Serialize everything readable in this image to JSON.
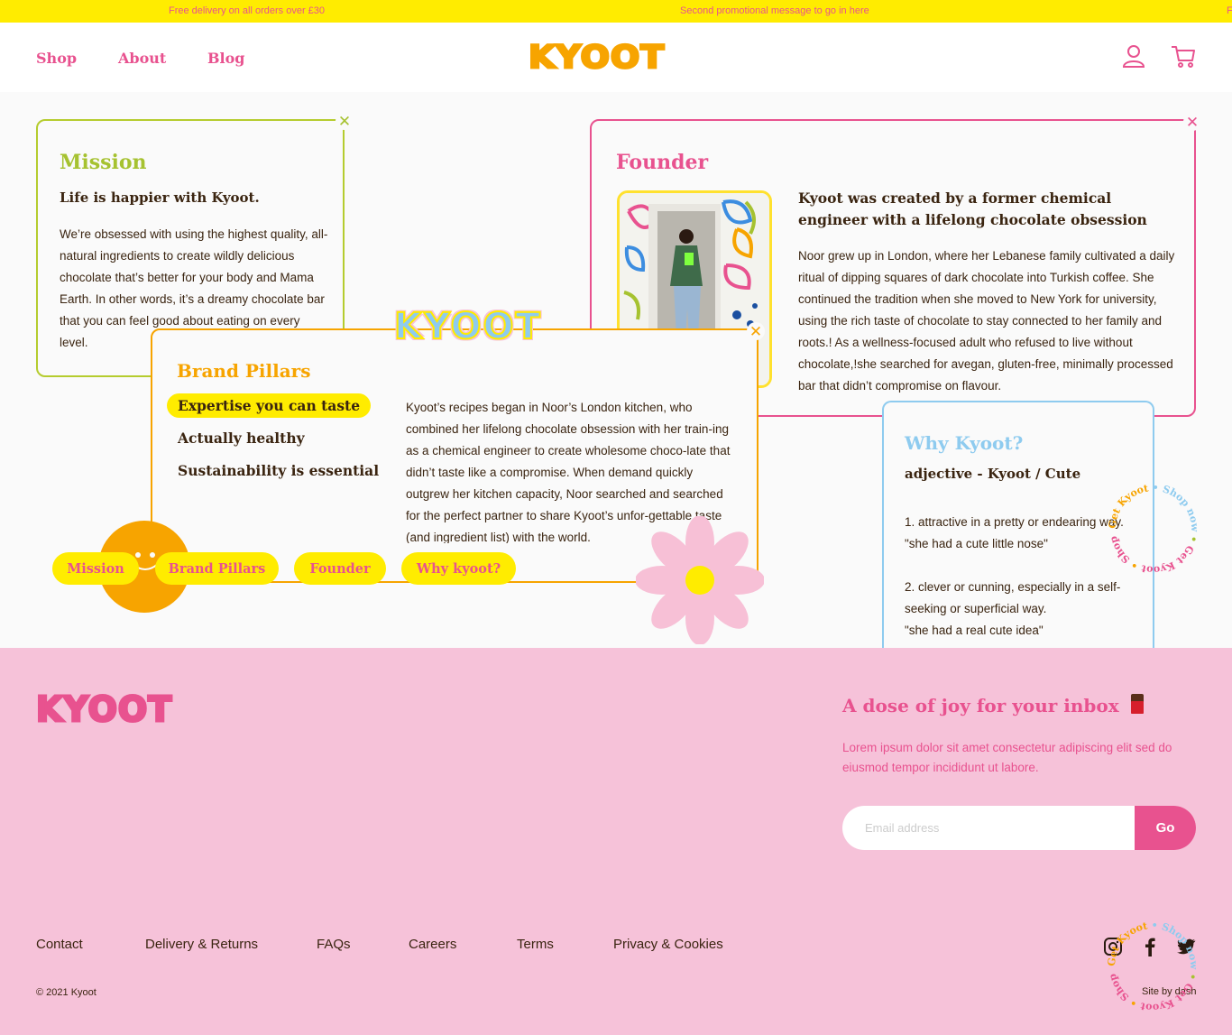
{
  "promo": {
    "message_1": "Free delivery on all orders over £30",
    "message_2": "Second promotional message to go in here",
    "message_3": "F"
  },
  "header": {
    "nav": [
      "Shop",
      "About",
      "Blog"
    ],
    "logo": "KYOOT",
    "icons": [
      "user-icon",
      "cart-icon"
    ]
  },
  "cards": {
    "mission": {
      "title": "Mission",
      "subtitle": "Life is happier with Kyoot.",
      "body": "We’re obsessed with using the highest quality, all-natural ingredients to create wildly delicious chocolate that’s better for your body and Mama Earth. In other words, it’s a dreamy chocolate bar that you can feel good about eating on every level."
    },
    "founder": {
      "title": "Founder",
      "subtitle": "Kyoot was created by a former chemical engineer with a lifelong chocolate obsession",
      "body": "Noor grew up in London, where her Lebanese family cultivated a daily ritual of dipping squares of dark chocolate into Turkish coffee. She continued the tradition when she moved to New York for university, using the rich taste of chocolate to stay connected to her family and roots.! As a wellness-focused adult who refused to live without chocolate,!she searched for avegan, gluten-free, minimally processed bar that didn’t compromise on flavour."
    },
    "brand_pillars": {
      "title": "Brand Pillars",
      "pillars": [
        "Expertise you can taste",
        "Actually healthy",
        "Sustainability is essential"
      ],
      "body": "Kyoot’s recipes began in Noor’s London kitchen, who combined her lifelong chocolate obsession with her train-ing as a chemical engineer to create wholesome choco-late that didn’t taste like a compromise. When demand quickly outgrew her kitchen capacity, Noor searched and searched for the perfect partner to share Kyoot’s unfor-gettable taste (and ingredient list) with the world."
    },
    "why": {
      "title": "Why Kyoot?",
      "subtitle": "adjective - Kyoot / Cute",
      "def1": "1. attractive in a pretty or endearing way.",
      "ex1": "\"she had a cute little nose\"",
      "def2": "2. clever or cunning, especially in a self-seeking or superficial way.",
      "ex2": "\"she had a real cute idea\""
    }
  },
  "sticker_logo": "KYOOT",
  "tabs": [
    "Mission",
    "Brand Pillars",
    "Founder",
    "Why kyoot?"
  ],
  "stamp_text": "Get Kyoot • Shop now • Get Kyoot • Shop now •",
  "footer": {
    "logo": "KYOOT",
    "newsletter_title": "A dose of joy for your inbox",
    "newsletter_text": "Lorem ipsum dolor sit amet consectetur adipiscing elit sed do eiusmod tempor incididunt ut labore.",
    "email_placeholder": "Email address",
    "go_label": "Go",
    "links": [
      "Contact",
      "Delivery & Returns",
      "FAQs",
      "Careers",
      "Terms",
      "Privacy & Cookies"
    ],
    "copyright": "© 2021 Kyoot",
    "credit": "Site by dash",
    "social": [
      "instagram-icon",
      "facebook-icon",
      "twitter-icon"
    ]
  },
  "colors": {
    "yellow": "#ffec00",
    "pink": "#e8528f",
    "orange": "#f7a400",
    "green": "#a6c230",
    "blue": "#8ecbef",
    "footer_bg": "#f6c2d9",
    "brown": "#3a2410"
  }
}
